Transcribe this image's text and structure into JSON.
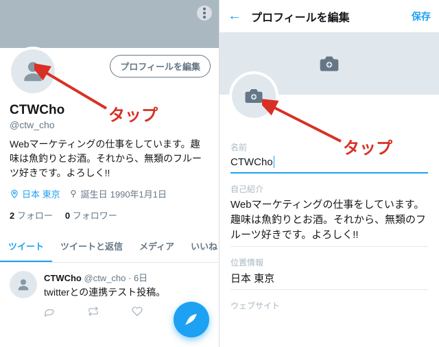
{
  "left": {
    "edit_button": "プロフィールを編集",
    "name": "CTWCho",
    "handle": "@ctw_cho",
    "bio": "Webマーケティングの仕事をしています。趣味は魚釣りとお酒。それから、無類のフルーツ好きです。よろしく!!",
    "location": "日本 東京",
    "birthday_label": "誕生日",
    "birthday_value": "1990年1月1日",
    "following_count": "2",
    "following_label": "フォロー",
    "followers_count": "0",
    "followers_label": "フォロワー",
    "tabs": [
      "ツイート",
      "ツイートと返信",
      "メディア",
      "いいね"
    ],
    "tweet": {
      "name": "CTWCho",
      "handle": "@ctw_cho",
      "date": "6日",
      "text": "twitterとの連携テスト投稿。"
    },
    "annotation": "タップ"
  },
  "right": {
    "title": "プロフィールを編集",
    "save": "保存",
    "fields": {
      "name_label": "名前",
      "name_value": "CTWCho",
      "bio_label": "自己紹介",
      "bio_value": "Webマーケティングの仕事をしています。趣味は魚釣りとお酒。それから、無類のフルーツ好きです。よろしく!!",
      "location_label": "位置情報",
      "location_value": "日本 東京",
      "website_label": "ウェブサイト"
    },
    "annotation": "タップ"
  }
}
